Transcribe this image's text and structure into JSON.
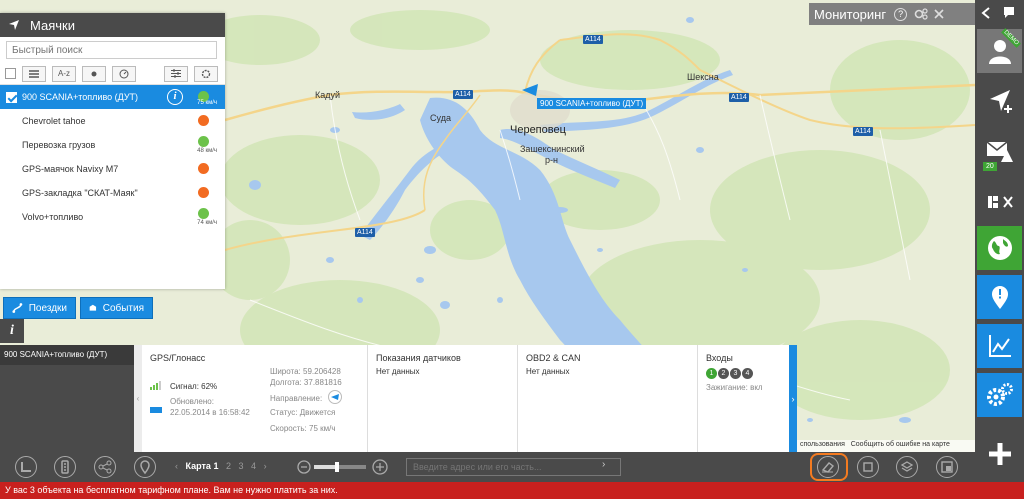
{
  "monitoring": {
    "title": "Мониторинг",
    "help": "?"
  },
  "map_labels": {
    "cherepovets": "Череповец",
    "zashekn": "Зашекснинский",
    "rn": "р-н",
    "suda": "Суда",
    "kaduy": "Кадуй",
    "sheksna": "Шексна",
    "road": "A114"
  },
  "map_marker": {
    "label": "900 SCANIA+топливо (ДУТ)"
  },
  "trackers_panel": {
    "title": "Маячки",
    "search_placeholder": "Быстрый поиск",
    "sort_label": "A-z",
    "items": [
      {
        "name": "900 SCANIA+топливо (ДУТ)",
        "status_color": "#6cc24a",
        "speed": "75 км/ч",
        "selected": true
      },
      {
        "name": "Chevrolet tahoe",
        "status_color": "#f26b21",
        "speed": ""
      },
      {
        "name": "Перевозка грузов",
        "status_color": "#6cc24a",
        "speed": "48 км/ч"
      },
      {
        "name": "GPS-маячок Navixy M7",
        "status_color": "#f26b21",
        "speed": ""
      },
      {
        "name": "GPS-закладка \"СКАТ-Маяк\"",
        "status_color": "#f26b21",
        "speed": ""
      },
      {
        "name": "Volvo+топливо",
        "status_color": "#6cc24a",
        "speed": "74 км/ч"
      }
    ],
    "trips_button": "Поездки",
    "events_button": "События"
  },
  "info_panel": {
    "tracker_name": "900 SCANIA+топливо (ДУТ)",
    "gps": {
      "title": "GPS/Глонасс",
      "signal": "Сигнал: 62%",
      "updated_label": "Обновлено:",
      "updated_value": "22.05.2014 в 16:58:42",
      "lat": "Широта: 59.206428",
      "lon": "Долгота: 37.881816",
      "direction": "Направление:",
      "status": "Статус: Движется",
      "speed": "Скорость: 75 км/ч"
    },
    "sensors": {
      "title": "Показания датчиков",
      "value": "Нет данных"
    },
    "obd": {
      "title": "OBD2 & CAN",
      "value": "Нет данных"
    },
    "inputs": {
      "title": "Входы",
      "ignition": "Зажигание: вкл",
      "numbers": [
        "1",
        "2",
        "3",
        "4"
      ]
    }
  },
  "copyright": {
    "terms": "спользования",
    "report": "Сообщить об ошибке на карте"
  },
  "bottom_bar": {
    "map_label": "Карта",
    "pages": [
      "1",
      "2",
      "3",
      "4"
    ],
    "address_placeholder": "Введите адрес или его часть..."
  },
  "right_bar": {
    "demo": "DEMO",
    "notifications_count": "20"
  },
  "status_message": "У вас 3 объекта на бесплатном тарифном плане. Вам не нужно платить за них."
}
